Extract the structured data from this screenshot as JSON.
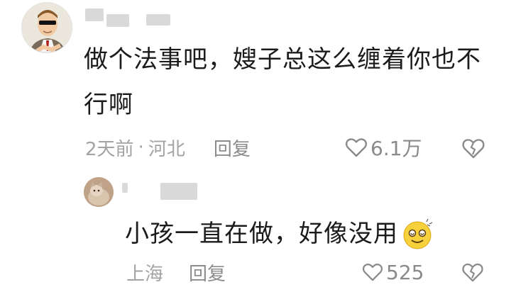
{
  "comment": {
    "text": "做个法事吧，嫂子总这么缠着你也不行啊",
    "time": "2天前",
    "separator": "·",
    "location": "河北",
    "reply_label": "回复",
    "likes": "6.1万"
  },
  "reply": {
    "text": "小孩一直在做，好像没用",
    "location": "上海",
    "reply_label": "回复",
    "likes": "525"
  },
  "colors": {
    "text": "#1b1b1b",
    "meta": "#a3a3a3",
    "icon": "#8a8a8a"
  }
}
